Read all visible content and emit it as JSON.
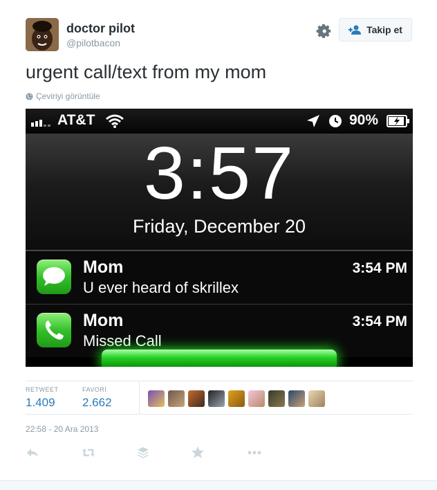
{
  "author": {
    "name": "doctor pilot",
    "handle": "@pilotbacon"
  },
  "follow_button": {
    "label": "Takip et"
  },
  "tweet": {
    "text": "urgent call/text from my mom",
    "translate_label": "Çeviriyi görüntüle"
  },
  "phone": {
    "status": {
      "carrier": "AT&T",
      "battery": "90%"
    },
    "time": "3:57",
    "date": "Friday, December 20",
    "notifications": [
      {
        "sender": "Mom",
        "message": "U ever heard of skrillex",
        "time": "3:54 PM",
        "icon": "messages-icon"
      },
      {
        "sender": "Mom",
        "message": "Missed Call",
        "time": "3:54 PM",
        "icon": "phone-icon"
      }
    ]
  },
  "stats": {
    "retweet_label": "RETWEET",
    "retweet_count": "1.409",
    "favorite_label": "FAVORİ",
    "favorite_count": "2.662"
  },
  "timestamp": "22:58 - 20 Ara 2013",
  "colors": {
    "link": "#2b7bb9",
    "muted": "#8899a6",
    "notification_green": "#34c12a"
  }
}
